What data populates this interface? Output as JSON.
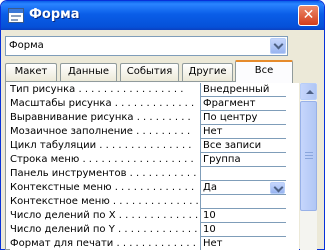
{
  "window": {
    "title": "Форма",
    "close_glyph": "✕"
  },
  "object_selector": {
    "value": "Форма"
  },
  "tabs": [
    {
      "label": "Макет"
    },
    {
      "label": "Данные"
    },
    {
      "label": "События"
    },
    {
      "label": "Другие"
    },
    {
      "label": "Все",
      "active": true
    }
  ],
  "properties": [
    {
      "label": "Тип рисунка . . . . . . . . . . . . . . . . .",
      "value": "Внедренный"
    },
    {
      "label": "Масштабы рисунка . . . . . . . . . . . . .",
      "value": "Фрагмент"
    },
    {
      "label": "Выравнивание рисунка . . . . . . . . .",
      "value": "По центру"
    },
    {
      "label": "Мозаичное заполнение . . . . . . . . .",
      "value": "Нет"
    },
    {
      "label": "Цикл табуляции . . . . . . . . . . . . . . .",
      "value": "Все записи"
    },
    {
      "label": "Строка меню . . . . . . . . . . . . . . . . . .",
      "value": "Группа"
    },
    {
      "label": "Панель инструментов . . . . . . . . . . . .",
      "value": ""
    },
    {
      "label": "Контекстные меню . . . . . . . . . . . . .",
      "value": "Да",
      "dropdown": true
    },
    {
      "label": "Контекстное меню . . . . . . . . . . . . . .",
      "value": ""
    },
    {
      "label": "Число делений по X . . . . . . . . . . . . .",
      "value": "10"
    },
    {
      "label": "Число делений по Y . . . . . . . . . . . . .",
      "value": "10"
    },
    {
      "label": "Формат для печати . . . . . . . . . . . . .",
      "value": "Нет"
    }
  ]
}
